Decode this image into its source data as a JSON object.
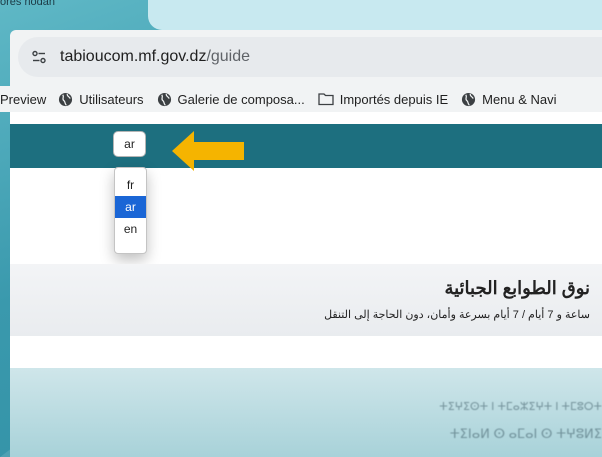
{
  "browser": {
    "prev_tab_label": "ores riodan",
    "url": {
      "domain": "tabioucom.mf.gov.dz",
      "path": "/guide"
    },
    "bookmarks": [
      {
        "label": "Preview",
        "icon": "none"
      },
      {
        "label": "Utilisateurs",
        "icon": "globe-icon"
      },
      {
        "label": "Galerie de composa...",
        "icon": "globe-icon"
      },
      {
        "label": "Importés depuis IE",
        "icon": "folder-icon"
      },
      {
        "label": "Menu & Navi",
        "icon": "globe-icon"
      }
    ]
  },
  "page": {
    "language_select": {
      "value": "ar",
      "options": [
        "fr",
        "ar",
        "en"
      ],
      "selected_option": "ar"
    },
    "hero": {
      "title": "نوق الطوابع الجبائية",
      "subtitle": "ساعة و 7 أيام / 7 أيام بسرعة وأمان، دون الحاجة إلى التنقل"
    },
    "blurred_text": [
      "ⵜⵉⵖⵉⵙⵜ ⵏ ⵜⵎⴰⵣⵉⵖⵜ ⵏ ⵜⵎⵓⵔⵜ",
      "ⵜⵉⵏⴰⵍ ⵙ ⴰⵎⴰⵏ ⵙ ⵜⵖⵓⵍⵉ"
    ]
  },
  "colors": {
    "nav_band": "#1d6f7f",
    "arrow": "#f5b400",
    "selected_option": "#1a66d6",
    "outer_background": "#3f9db0"
  }
}
